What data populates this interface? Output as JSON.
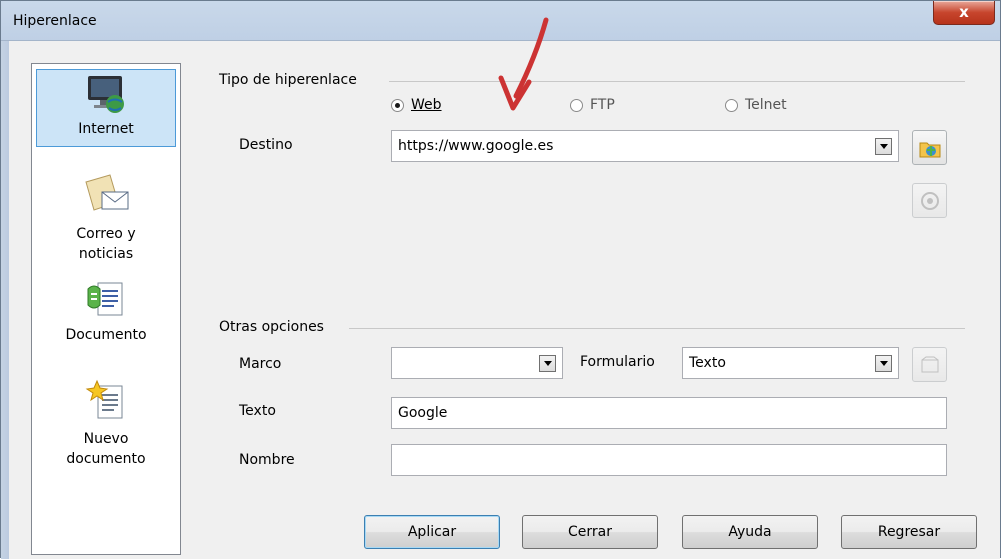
{
  "window": {
    "title": "Hiperenlace",
    "close_label": "x"
  },
  "sidebar": {
    "items": [
      {
        "label": "Internet",
        "icon": "globe-monitor-icon",
        "selected": true
      },
      {
        "label": "Correo y\nnoticias",
        "icon": "mail-icon",
        "selected": false
      },
      {
        "label": "Documento",
        "icon": "document-link-icon",
        "selected": false
      },
      {
        "label": "Nuevo\ndocumento",
        "icon": "new-document-icon",
        "selected": false
      }
    ]
  },
  "hyperlink_type": {
    "group_label": "Tipo de hiperenlace",
    "options": [
      {
        "label": "Web",
        "selected": true
      },
      {
        "label": "FTP",
        "selected": false
      },
      {
        "label": "Telnet",
        "selected": false
      }
    ],
    "destino_label": "Destino",
    "destino_value": "https://www.google.es"
  },
  "other_options": {
    "group_label": "Otras opciones",
    "marco_label": "Marco",
    "marco_value": "",
    "formulario_label": "Formulario",
    "formulario_value": "Texto",
    "texto_label": "Texto",
    "texto_value": "Google",
    "nombre_label": "Nombre",
    "nombre_value": ""
  },
  "buttons": {
    "apply": "Aplicar",
    "close": "Cerrar",
    "help": "Ayuda",
    "back": "Regresar"
  },
  "colors": {
    "accent": "#cc3333",
    "selection": "#cce4f7"
  }
}
